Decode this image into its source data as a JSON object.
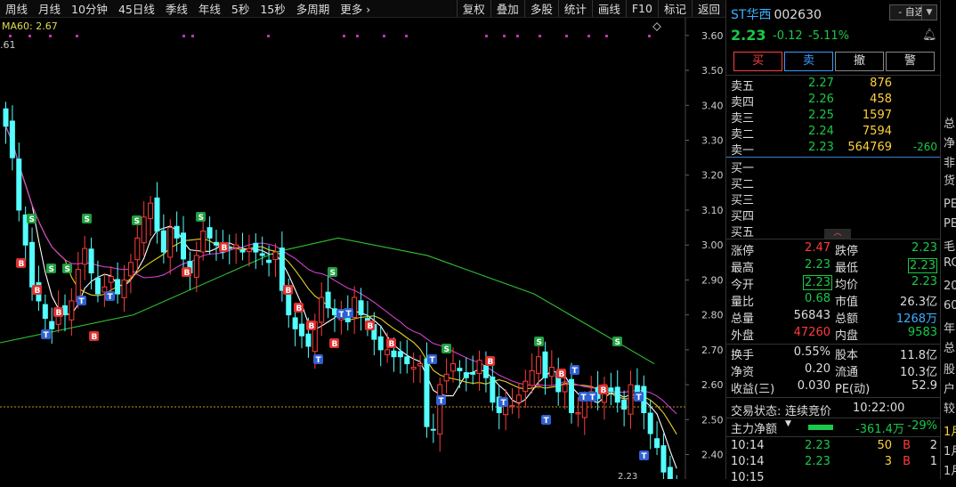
{
  "topbar": {
    "left": [
      "周线",
      "月线",
      "10分钟",
      "45日线",
      "季线",
      "年线",
      "5秒",
      "15秒",
      "多周期",
      "更多 ›"
    ],
    "right": [
      "复权",
      "叠加",
      "多股",
      "统计",
      "画线",
      "F10",
      "标记",
      "返回"
    ]
  },
  "chart": {
    "ma_label": "MA60: 2.67",
    "top_left_price": ".61",
    "bottom_label": "2.23",
    "y_ticks": [
      "3.60",
      "3.50",
      "3.40",
      "3.30",
      "3.20",
      "3.10",
      "3.00",
      "2.90",
      "2.80",
      "2.70",
      "2.60",
      "2.50",
      "2.40"
    ]
  },
  "stock": {
    "name": "ST华西",
    "code": "002630",
    "watch_label": "- 自选",
    "price": "2.23",
    "change": "-0.12",
    "change_pct": "-5.11%",
    "buttons": [
      "买",
      "卖",
      "撤",
      "警"
    ]
  },
  "order_book": {
    "asks": [
      {
        "label": "卖五",
        "price": "2.27",
        "vol": "876",
        "delta": ""
      },
      {
        "label": "卖四",
        "price": "2.26",
        "vol": "458",
        "delta": ""
      },
      {
        "label": "卖三",
        "price": "2.25",
        "vol": "1597",
        "delta": ""
      },
      {
        "label": "卖二",
        "price": "2.24",
        "vol": "7594",
        "delta": ""
      },
      {
        "label": "卖一",
        "price": "2.23",
        "vol": "564769",
        "delta": "-260"
      }
    ],
    "bids": [
      "买一",
      "买二",
      "买三",
      "买四",
      "买五"
    ]
  },
  "quote": {
    "zhangting_label": "涨停",
    "zhangting": "2.47",
    "dieting_label": "跌停",
    "dieting": "2.23",
    "zuigao_label": "最高",
    "zuigao": "2.23",
    "zuidi_label": "最低",
    "zuidi": "2.23",
    "jinkai_label": "今开",
    "jinkai": "2.23",
    "junjia_label": "均价",
    "junjia": "2.23",
    "liangbi_label": "量比",
    "liangbi": "0.68",
    "shizhi_label": "市值",
    "shizhi": "26.3亿",
    "zongliang_label": "总量",
    "zongliang": "56843",
    "zonge_label": "总额",
    "zonge": "1268万",
    "waipan_label": "外盘",
    "waipan": "47260",
    "neipan_label": "内盘",
    "neipan": "9583",
    "huanshou_label": "换手",
    "huanshou": "0.55%",
    "guben_label": "股本",
    "guben": "11.8亿",
    "jingzi_label": "净资",
    "jingzi": "0.20",
    "liutong_label": "流通",
    "liutong": "10.3亿",
    "shouyi_label": "收益(三)",
    "shouyi": "0.030",
    "pe_label": "PE(动)",
    "pe": "52.9"
  },
  "status": {
    "label": "交易状态:",
    "value": "连续竞价",
    "time": "10:22:00",
    "main_label": "主力净额",
    "main_value": "-361.4万",
    "main_pct": "-29%"
  },
  "ticks": [
    {
      "time": "10:14",
      "price": "2.23",
      "vol": "50",
      "side": "B",
      "n": "2"
    },
    {
      "time": "10:14",
      "price": "2.23",
      "vol": "3",
      "side": "B",
      "n": "1"
    },
    {
      "time": "10:15",
      "price": "2.23",
      "vol": "",
      "side": "",
      "n": ""
    }
  ],
  "edge": [
    "总",
    "净",
    "非",
    "货",
    "PE",
    "PE",
    "毛",
    "RC",
    "20",
    "60",
    "年",
    "总",
    "股",
    "户",
    "较",
    "1月",
    "1月",
    "1月"
  ]
}
